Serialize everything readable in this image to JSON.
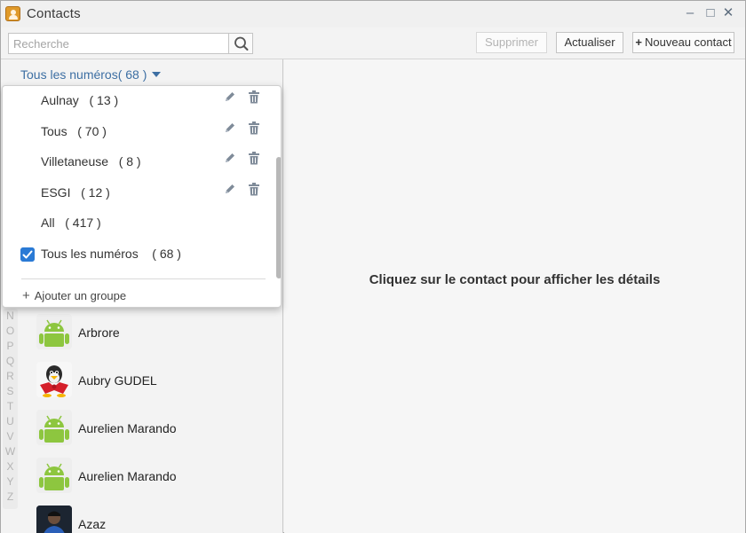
{
  "window": {
    "title": "Contacts",
    "app_icon": "contacts-book-icon",
    "controls": {
      "minimize": "–",
      "maximize": "□",
      "close": "✕"
    }
  },
  "toolbar": {
    "search_placeholder": "Recherche",
    "search_icon": "search-icon",
    "delete_label": "Supprimer",
    "refresh_label": "Actualiser",
    "new_contact_plus": "+",
    "new_contact_label": "Nouveau contact"
  },
  "groups": {
    "selected_label": "Tous les numéros( 68 )",
    "items": [
      {
        "label": "Aulnay   ( 13 )",
        "editable": true
      },
      {
        "label": "Tous   ( 70 )",
        "editable": true
      },
      {
        "label": "Villetaneuse   ( 8 )",
        "editable": true
      },
      {
        "label": "ESGI   ( 12 )",
        "editable": true
      },
      {
        "label": "All   ( 417 )",
        "editable": false
      },
      {
        "label": "Tous les numéros    ( 68 )",
        "editable": false,
        "checked": true
      }
    ],
    "add_plus": "+",
    "add_label": "Ajouter un groupe"
  },
  "alphabet": [
    "N",
    "O",
    "P",
    "Q",
    "R",
    "S",
    "T",
    "U",
    "V",
    "W",
    "X",
    "Y",
    "Z"
  ],
  "contacts": [
    {
      "name": "Arbrore",
      "avatar": "android-icon"
    },
    {
      "name": "Aubry GUDEL",
      "avatar": "tux-icon"
    },
    {
      "name": "Aurelien Marando",
      "avatar": "android-icon"
    },
    {
      "name": "Aurelien Marando",
      "avatar": "android-icon"
    },
    {
      "name": "Azaz",
      "avatar": "photo"
    }
  ],
  "details": {
    "placeholder": "Cliquez sur le contact pour afficher les détails"
  },
  "colors": {
    "accent": "#3d6fa3",
    "checkbox": "#2a7ad5",
    "android_green": "#8dc63f"
  }
}
